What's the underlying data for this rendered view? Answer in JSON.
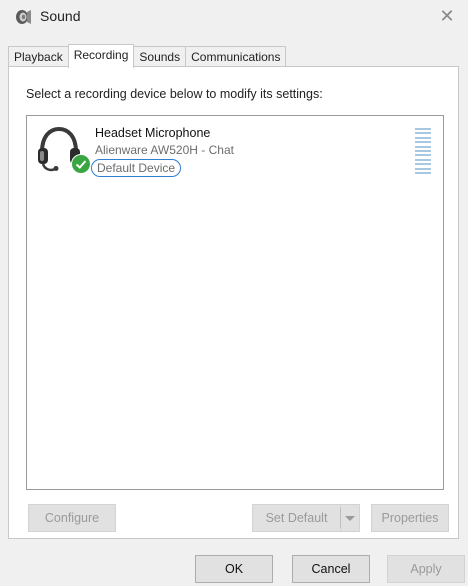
{
  "window": {
    "title": "Sound",
    "close_glyph": "✕"
  },
  "tabs": [
    {
      "label": "Playback",
      "active": false
    },
    {
      "label": "Recording",
      "active": true
    },
    {
      "label": "Sounds",
      "active": false
    },
    {
      "label": "Communications",
      "active": false
    }
  ],
  "recording": {
    "instruction": "Select a recording device below to modify its settings:",
    "devices": [
      {
        "name": "Headset Microphone",
        "description": "Alienware AW520H - Chat",
        "status": "Default Device",
        "icon": "headset-icon",
        "status_icon": "checkmark-icon"
      }
    ],
    "buttons": {
      "configure": "Configure",
      "set_default": "Set Default",
      "properties": "Properties"
    }
  },
  "dialog_buttons": {
    "ok": "OK",
    "cancel": "Cancel",
    "apply": "Apply"
  },
  "colors": {
    "status_outline": "#2f7fd1",
    "check_badge": "#3aa642",
    "level_meter": "#a8c7e0"
  }
}
